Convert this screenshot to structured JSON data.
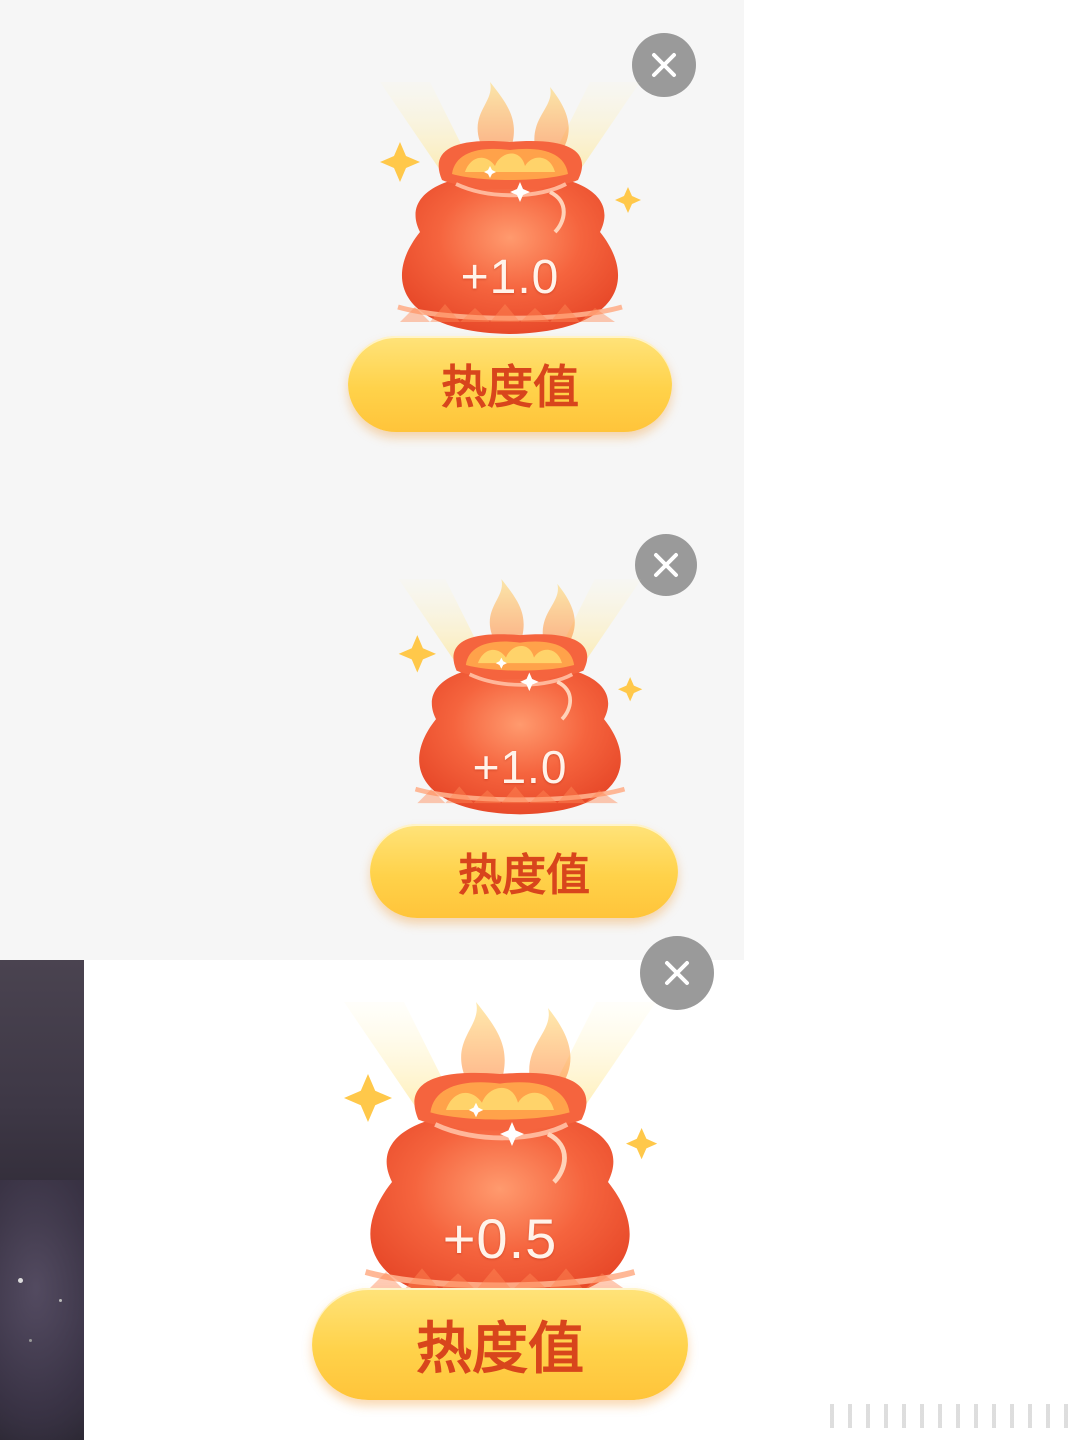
{
  "cards": [
    {
      "value": "+1.0",
      "label": "热度值"
    },
    {
      "value": "+1.0",
      "label": "热度值"
    },
    {
      "value": "+0.5",
      "label": "热度值"
    }
  ],
  "icons": {
    "close": "close-icon",
    "bag": "lucky-bag-icon",
    "sparkle": "sparkle-icon"
  },
  "colors": {
    "bag_red": "#f0603c",
    "label_yellow": "#ffd24a",
    "label_text": "#d8451c",
    "close_gray": "#9a9a9a"
  }
}
